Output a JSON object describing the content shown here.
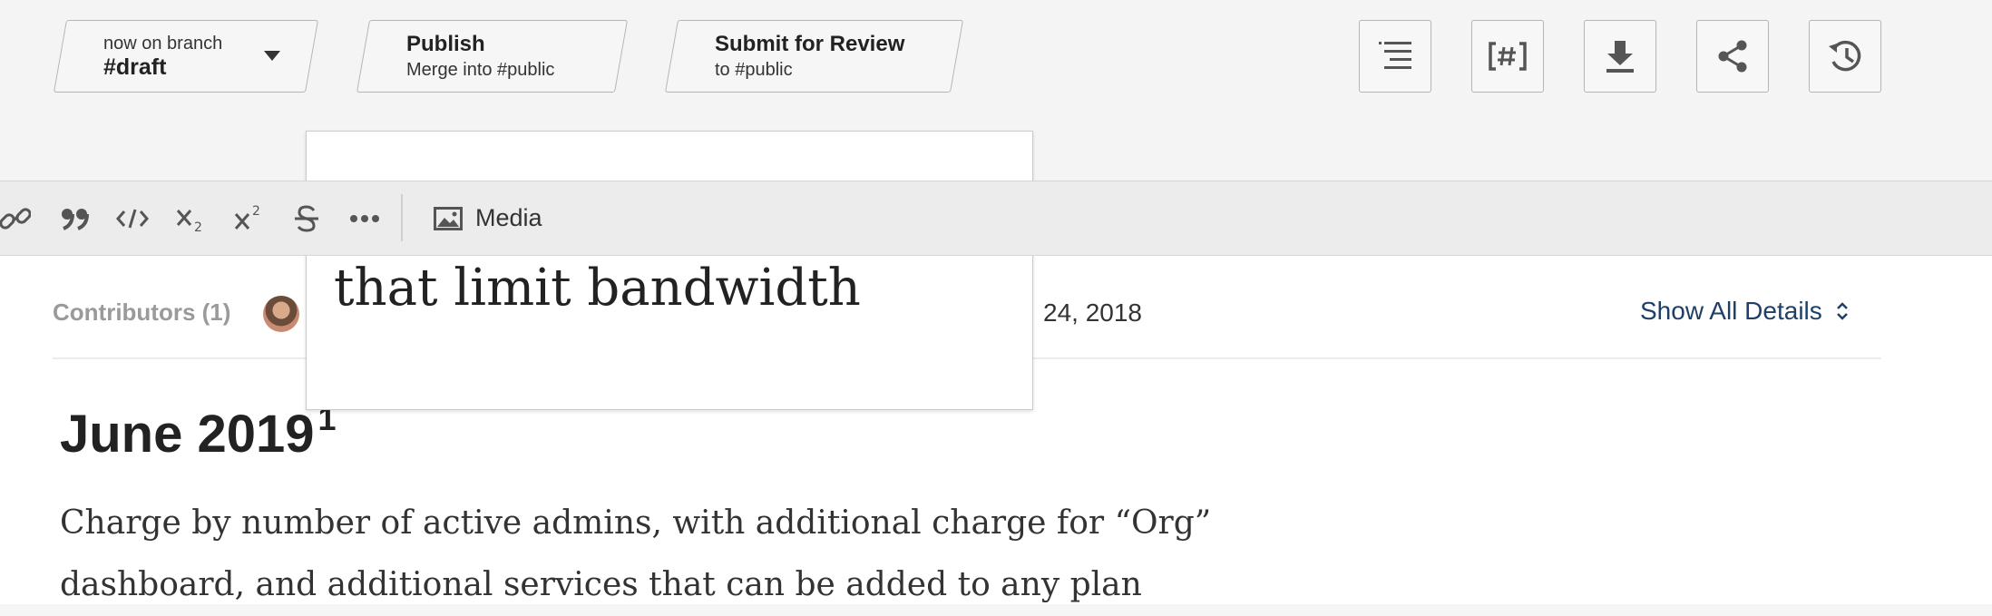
{
  "header": {
    "branch": {
      "prefix": "now on branch",
      "name": "#draft"
    },
    "publish": {
      "title": "Publish",
      "subtitle": "Merge into #public"
    },
    "review": {
      "title": "Submit for Review",
      "subtitle": "to #public"
    }
  },
  "popup": {
    "text": "that limit bandwidth"
  },
  "toolbar": {
    "media_label": "Media"
  },
  "meta": {
    "contributors_label": "Contributors (1)",
    "date_fragment": "24, 2018",
    "show_details_label": "Show All Details"
  },
  "document": {
    "heading": "June 2019",
    "footnote_ref": "1",
    "body_line_1": "Charge by number of active admins, with additional charge for “Org”",
    "body_line_2": "dashboard, and additional services that can be added to any plan"
  }
}
